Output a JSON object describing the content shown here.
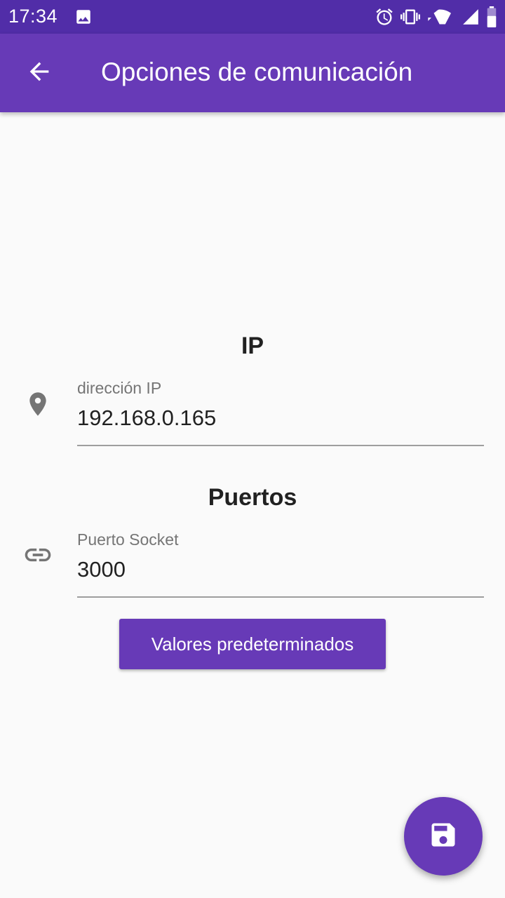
{
  "status_bar": {
    "time": "17:34",
    "left_icons": [
      "image-icon"
    ],
    "right_icons": [
      "alarm-icon",
      "vibrate-icon",
      "wifi-icon",
      "cell-signal-icon",
      "battery-icon"
    ]
  },
  "app_bar": {
    "title": "Opciones de comunicación",
    "nav_icon": "arrow-back-icon"
  },
  "sections": {
    "ip": {
      "title": "IP",
      "field_label": "dirección IP",
      "field_value": "192.168.0.165",
      "icon": "location-pin-icon"
    },
    "ports": {
      "title": "Puertos",
      "field_label": "Puerto Socket",
      "field_value": "3000",
      "icon": "link-icon"
    }
  },
  "defaults_button": {
    "label": "Valores predeterminados"
  },
  "fab": {
    "icon": "save-icon"
  },
  "colors": {
    "status_bar": "#512da8",
    "primary": "#673ab7",
    "background": "#fafafa",
    "text_primary": "#212121",
    "text_secondary": "#757575",
    "icon_grey": "#757575"
  }
}
